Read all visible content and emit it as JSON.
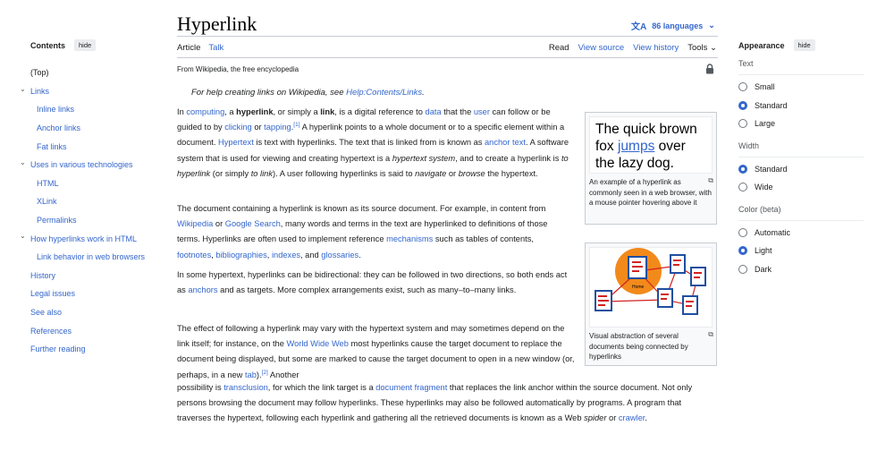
{
  "header": {
    "title": "Hyperlink",
    "languages": "86 languages",
    "tab_article": "Article",
    "tab_talk": "Talk",
    "tab_read": "Read",
    "tab_view_source": "View source",
    "tab_view_history": "View history",
    "tools": "Tools",
    "from_line": "From Wikipedia, the free encyclopedia"
  },
  "toc": {
    "title": "Contents",
    "hide": "hide",
    "items": [
      {
        "label": "(Top)"
      },
      {
        "label": "Links"
      },
      {
        "label": "Inline links"
      },
      {
        "label": "Anchor links"
      },
      {
        "label": "Fat links"
      },
      {
        "label": "Uses in various technologies"
      },
      {
        "label": "HTML"
      },
      {
        "label": "XLink"
      },
      {
        "label": "Permalinks"
      },
      {
        "label": "How hyperlinks work in HTML"
      },
      {
        "label": "Link behavior in web browsers"
      },
      {
        "label": "History"
      },
      {
        "label": "Legal issues"
      },
      {
        "label": "See also"
      },
      {
        "label": "References"
      },
      {
        "label": "Further reading"
      }
    ]
  },
  "hatnote": {
    "prefix": "For help creating links on Wikipedia, see ",
    "link": "Help:Contents/Links",
    "suffix": "."
  },
  "p1": {
    "t1": "In ",
    "l1": "computing",
    "t2": ", a ",
    "b1": "hyperlink",
    "t3": ", or simply a ",
    "b2": "link",
    "t4": ", is a digital reference to ",
    "l2": "data",
    "t5": " that the ",
    "l3": "user",
    "t6": " can follow or be guided to by ",
    "l4": "clicking",
    "t7": " or ",
    "l5": "tapping",
    ".": "",
    "ref1": "[1]",
    "t8": " A hyperlink points to a whole document or to a specific element within a document. ",
    "l6": "Hypertext",
    "t9": " is text with hyperlinks. The text that is linked from is known as ",
    "l7": "anchor text",
    "t10": ". A software system that is used for viewing and creating hypertext is a ",
    "i1": "hypertext system",
    "t11": ", and to create a hyperlink is ",
    "i2": "to hyperlink",
    "t12": " (or simply ",
    "i3": "to link",
    "t13": "). A user following hyperlinks is said to ",
    "i4": "navigate",
    "t14": " or ",
    "i5": "browse",
    "t15": " the hypertext."
  },
  "p2": {
    "t1": "The document containing a hyperlink is known as its source document. For example, in content from ",
    "l1": "Wikipedia",
    "t2": " or ",
    "l2": "Google Search",
    "t3": ", many words and terms in the text are hyperlinked to definitions of those terms. Hyperlinks are often used to implement reference ",
    "l3": "mechanisms",
    "t4": " such as tables of contents, ",
    "l4": "footnotes",
    "t5": ", ",
    "l5": "bibliographies",
    "t6": ", ",
    "l6": "indexes",
    "t7": ", and ",
    "l7": "glossaries",
    "t8": "."
  },
  "p3": {
    "t1": "In some hypertext, hyperlinks can be bidirectional: they can be followed in two directions, so both ends act as ",
    "l1": "anchors",
    "t2": " and as targets. More complex arrangements exist, such as many–to–many links."
  },
  "p4": {
    "t1": "The effect of following a hyperlink may vary with the hypertext system and may sometimes depend on the link itself; for instance, on the ",
    "l1": "World Wide Web",
    "t2": " most hyperlinks cause the target document to replace the document being displayed, but some are marked to cause the target document to open in a new window (or, perhaps, in a new ",
    "l2": "tab",
    "t3": ").",
    "ref": "[2]",
    "t4": " Another"
  },
  "p5": {
    "t1": "possibility is ",
    "l1": "transclusion",
    "t2": ", for which the link target is a ",
    "l2": "document fragment",
    "t3": " that replaces the link anchor within the source document. Not only persons browsing the document may follow hyperlinks. These hyperlinks may also be followed automatically by programs. A program that traverses the hypertext, following each hyperlink and gathering all the retrieved documents is known as a Web ",
    "i1": "spider",
    "t4": " or ",
    "l3": "crawler",
    "t5": "."
  },
  "fig1": {
    "line1": "The quick brown",
    "line2a": "fox ",
    "line2link": "jumps",
    "line2b": " over",
    "line3": "the lazy dog.",
    "caption": "An example of a hyperlink as commonly seen in a web browser, with a mouse pointer hovering above it"
  },
  "fig2": {
    "home_label": "Home",
    "caption": "Visual abstraction of several documents being connected by hyperlinks"
  },
  "appearance": {
    "title": "Appearance",
    "hide": "hide",
    "text_label": "Text",
    "text_options": [
      {
        "label": "Small",
        "on": false
      },
      {
        "label": "Standard",
        "on": true
      },
      {
        "label": "Large",
        "on": false
      }
    ],
    "width_label": "Width",
    "width_options": [
      {
        "label": "Standard",
        "on": true
      },
      {
        "label": "Wide",
        "on": false
      }
    ],
    "color_label": "Color (beta)",
    "color_options": [
      {
        "label": "Automatic",
        "on": false
      },
      {
        "label": "Light",
        "on": true
      },
      {
        "label": "Dark",
        "on": false
      }
    ]
  },
  "colors": {
    "link": "#3366cc",
    "accent": "#3366cc",
    "diagram_orange": "#f28a1b",
    "diagram_blue": "#1f4fa0",
    "diagram_red": "#d22222"
  }
}
